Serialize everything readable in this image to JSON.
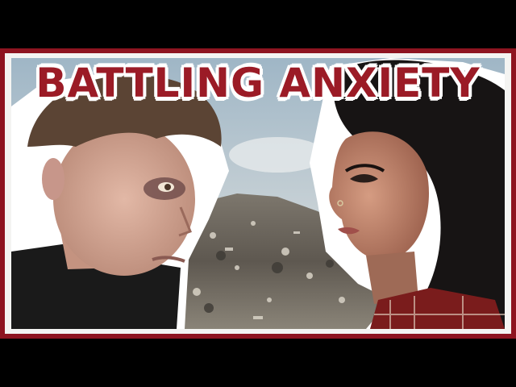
{
  "thumbnail": {
    "title": "BATTLING ANXIETY",
    "colors": {
      "frame": "#8e1420",
      "title_text": "#9b1b26",
      "title_outline": "#ffffff",
      "letterbox": "#000000"
    },
    "scene": {
      "left_subject": "young man with dark-circled eyes, dark t-shirt",
      "right_subject": "woman with long dark hair, plaid shirt, nose ring",
      "background": "landfill of rubbish under a hazy sky"
    }
  }
}
